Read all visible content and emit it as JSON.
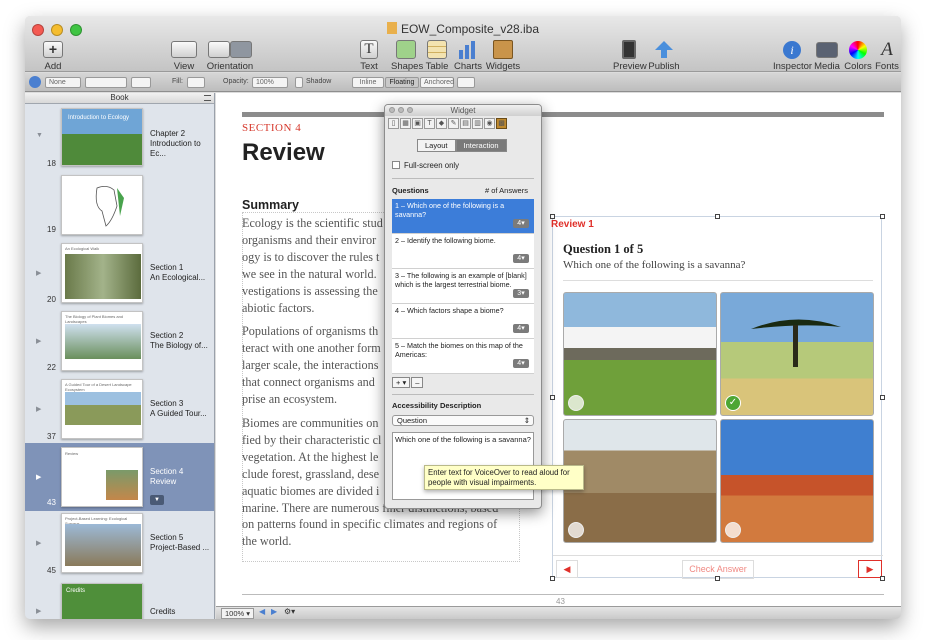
{
  "window": {
    "title": "EOW_Composite_v28.iba"
  },
  "toolbar": {
    "add_pages": "Add Pages",
    "view": "View",
    "orientation": "Orientation",
    "text_box": "Text Box",
    "shapes": "Shapes",
    "table": "Table",
    "charts": "Charts",
    "widgets": "Widgets",
    "preview": "Preview",
    "publish": "Publish",
    "inspector": "Inspector",
    "media": "Media",
    "colors": "Colors",
    "fonts": "Fonts"
  },
  "format_bar": {
    "none": "None",
    "fill": "Fill:",
    "opacity": "Opacity:",
    "opacity_value": "100%",
    "shadow": "Shadow",
    "inline": "Inline",
    "floating": "Floating",
    "anchored": "Anchored"
  },
  "sidebar": {
    "header": "Book",
    "items": [
      {
        "page": "18",
        "title": "Chapter 2",
        "subtitle": "Introduction to Ec...",
        "thumb_title": "Introduction to Ecology"
      },
      {
        "page": "19",
        "title": "",
        "subtitle": ""
      },
      {
        "page": "20",
        "title": "Section 1",
        "subtitle": "An Ecological...",
        "thumb_title": "An Ecological Walk"
      },
      {
        "page": "22",
        "title": "Section 2",
        "subtitle": "The Biology of...",
        "thumb_title": "The Biology of Plant Biomes and Landscapes"
      },
      {
        "page": "37",
        "title": "Section 3",
        "subtitle": "A Guided Tour...",
        "thumb_title": "A Guided Tour of a Desert Landscape Ecosystem"
      },
      {
        "page": "43",
        "title": "Section 4",
        "subtitle": "Review",
        "thumb_title": "Review"
      },
      {
        "page": "45",
        "title": "Section 5",
        "subtitle": "Project-Based ...",
        "thumb_title": "Project-Based Learning: Ecological Surveys"
      },
      {
        "page": "",
        "title": "Credits",
        "subtitle": "",
        "thumb_title": "Credits"
      }
    ]
  },
  "page": {
    "section_label": "SECTION 4",
    "title": "Review",
    "summary_heading": "Summary",
    "paragraphs": [
      "Ecology is the scientific stud… organisms and their enviro… ogy is to discover the rules t… we see in the natural world.… vestigations is assessing the… abiotic factors.",
      "Populations of organisms th… teract with one another form… larger scale, the interaction… that connect organisms and … prise an ecosystem.",
      "Biomes are communities on … fied by their characteristic c… vegetation. At the highest le… clude forest, grassland, dese… aquatic biomes are divided … marine. There are numerous finer distinctions, based on patterns found in specific climates and regions of the world."
    ],
    "lines": [
      [
        "Ecology is the scientific stud",
        "organisms and their enviror",
        "ogy is to discover the rules t",
        "we see in the natural world.",
        "vestigations is assessing the",
        "abiotic factors."
      ],
      [
        "Populations of organisms th",
        "teract with one another form",
        "larger scale, the interactions",
        "that connect organisms and",
        "prise an ecosystem."
      ],
      [
        "Biomes are communities on",
        "fied by their characteristic cl",
        "vegetation. At the highest le",
        "clude forest, grassland, dese",
        "aquatic biomes are divided i",
        "marine. There are numerous finer distinctions, based",
        "on patterns found in specific climates and regions of",
        "the world."
      ]
    ],
    "page_number": "43"
  },
  "review_widget": {
    "label": "Review 1",
    "question_header": "Question 1 of 5",
    "question_text": "Which one of the following is a savanna?",
    "check_answer": "Check Answer",
    "selected_index": 1
  },
  "inspector": {
    "title": "Widget",
    "tab_layout": "Layout",
    "tab_interaction": "Interaction",
    "fullscreen": "Full-screen only",
    "questions_label": "Questions",
    "answers_label": "# of Answers",
    "questions": [
      {
        "text": "1 – Which one of the following is a savanna?",
        "count": "4"
      },
      {
        "text": "2 – Identify the following biome.",
        "count": "4"
      },
      {
        "text": "3 – The following is an example of  [blank]  which is the largest terrestrial biome.",
        "count": "3"
      },
      {
        "text": "4 – Which factors shape a biome?",
        "count": "4"
      },
      {
        "text": "5 – Match the biomes on this map of the Americas:",
        "count": "4"
      }
    ],
    "add": "+ ▾",
    "remove": "–",
    "access_label": "Accessibility Description",
    "access_select": "Question",
    "access_text": "Which one of the following is a savanna?"
  },
  "tooltip": "Enter text for VoiceOver to read aloud for people with visual impairments.",
  "bottom": {
    "zoom": "100%"
  }
}
